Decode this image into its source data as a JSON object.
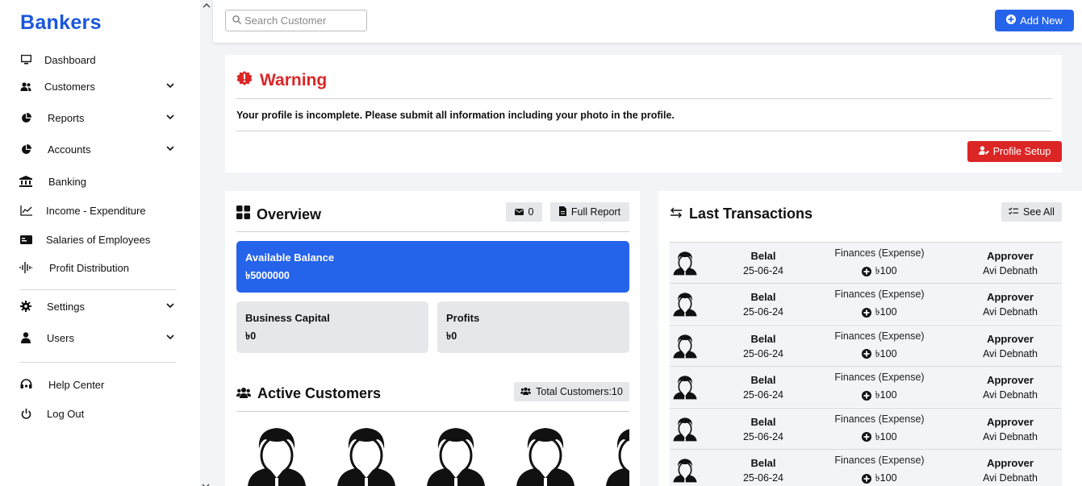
{
  "app": {
    "logo_text": "Bankers"
  },
  "sidebar": {
    "items": [
      {
        "label": "Dashboard",
        "icon": "monitor-icon",
        "has_chevron": false
      },
      {
        "label": "Customers",
        "icon": "users-icon",
        "has_chevron": true
      },
      {
        "label": "Reports",
        "icon": "pie-chart-icon",
        "has_chevron": true
      },
      {
        "label": "Accounts",
        "icon": "pie-chart-icon",
        "has_chevron": true
      },
      {
        "label": "Banking",
        "icon": "bank-icon",
        "has_chevron": false
      },
      {
        "label": "Income - Expenditure",
        "icon": "line-chart-icon",
        "has_chevron": false
      },
      {
        "label": "Salaries of Employees",
        "icon": "id-card-icon",
        "has_chevron": false
      },
      {
        "label": "Profit Distribution",
        "icon": "waveform-icon",
        "has_chevron": false
      },
      {
        "label": "Settings",
        "icon": "gear-icon",
        "has_chevron": true
      },
      {
        "label": "Users",
        "icon": "user-icon",
        "has_chevron": true
      },
      {
        "label": "Help Center",
        "icon": "headset-icon",
        "has_chevron": false
      },
      {
        "label": "Log Out",
        "icon": "power-icon",
        "has_chevron": false
      }
    ]
  },
  "topbar": {
    "search_placeholder": "Search Customer",
    "add_new_label": "Add New"
  },
  "warning": {
    "title": "Warning",
    "message": "Your profile is incomplete. Please submit all information including your photo in the profile.",
    "button_label": "Profile Setup"
  },
  "overview": {
    "title": "Overview",
    "message_count": "0",
    "full_report_label": "Full Report",
    "available_balance": {
      "label": "Available Balance",
      "value": "৳5000000"
    },
    "business_capital": {
      "label": "Business Capital",
      "value": "৳0"
    },
    "profits": {
      "label": "Profits",
      "value": "৳0"
    }
  },
  "active_customers": {
    "title": "Active Customers",
    "total_label": "Total Customers:10"
  },
  "transactions": {
    "title": "Last Transactions",
    "see_all_label": "See All",
    "rows": [
      {
        "name": "Belal",
        "date": "25-06-24",
        "category": "Finances (Expense)",
        "amount": "৳100",
        "role": "Approver",
        "approver": "Avi Debnath"
      },
      {
        "name": "Belal",
        "date": "25-06-24",
        "category": "Finances (Expense)",
        "amount": "৳100",
        "role": "Approver",
        "approver": "Avi Debnath"
      },
      {
        "name": "Belal",
        "date": "25-06-24",
        "category": "Finances (Expense)",
        "amount": "৳100",
        "role": "Approver",
        "approver": "Avi Debnath"
      },
      {
        "name": "Belal",
        "date": "25-06-24",
        "category": "Finances (Expense)",
        "amount": "৳100",
        "role": "Approver",
        "approver": "Avi Debnath"
      },
      {
        "name": "Belal",
        "date": "25-06-24",
        "category": "Finances (Expense)",
        "amount": "৳100",
        "role": "Approver",
        "approver": "Avi Debnath"
      },
      {
        "name": "Belal",
        "date": "25-06-24",
        "category": "Finances (Expense)",
        "amount": "৳100",
        "role": "Approver",
        "approver": "Avi Debnath"
      }
    ]
  },
  "colors": {
    "primary": "#2563eb",
    "danger": "#dc2626",
    "muted_bg": "#e5e7eb"
  }
}
